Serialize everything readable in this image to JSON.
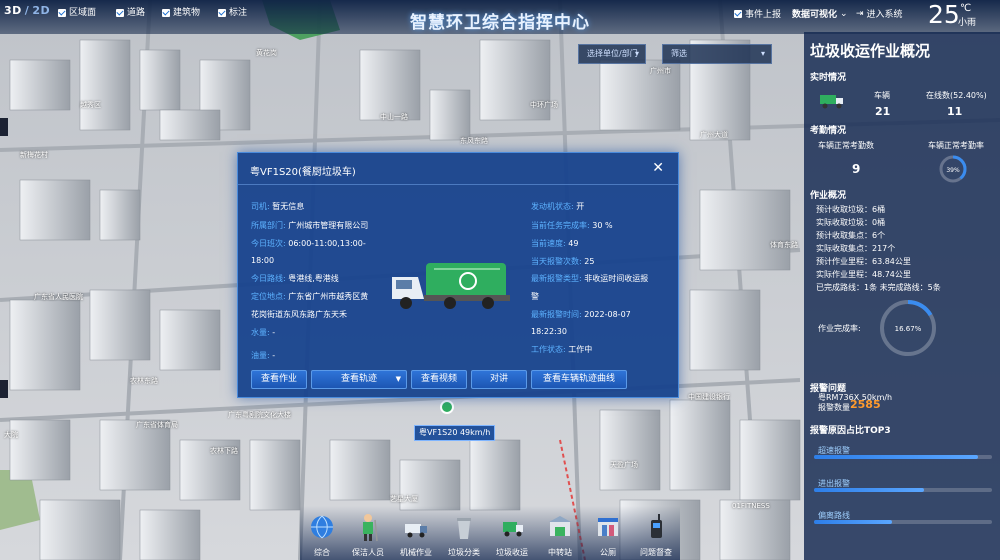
{
  "header": {
    "title": "智慧环卫综合指挥中心",
    "view_3d": "3D",
    "view_sep": "/",
    "view_2d": "2D",
    "layers": [
      "区域面",
      "道路",
      "建筑物",
      "标注"
    ],
    "event_report": "事件上报",
    "data_visual": "数据可视化",
    "enter_system": "进入系统",
    "temperature": "25",
    "temp_unit": "℃",
    "weather": "小雨",
    "select_unit_placeholder": "选择单位/部门",
    "filter_placeholder": "筛选"
  },
  "colors": {
    "accent": "#1b6fd1",
    "panel_bg": "#142850",
    "label_blue": "#5db2ff",
    "highlight_orange": "#ff9b2e",
    "vehicle_green": "#2fae5f"
  },
  "dialog": {
    "title": "粤VF1S20(餐厨垃圾车)",
    "left_fields": [
      {
        "k": "司机:",
        "v": "暂无信息"
      },
      {
        "k": "所属部门:",
        "v": "广州城市管理有限公司"
      },
      {
        "k": "今日班次:",
        "v": "06:00-11:00,13:00-"
      },
      {
        "k": "",
        "v": "18:00"
      },
      {
        "k": "今日路线:",
        "v": "粤港线,粤港线"
      },
      {
        "k": "定位地点:",
        "v": "广东省广州市越秀区黄"
      },
      {
        "k": "",
        "v": "花岗街道东风东路广东天禾"
      },
      {
        "k": "水量:",
        "v": "-"
      },
      {
        "k": "油量:",
        "v": "-"
      }
    ],
    "right_fields": [
      {
        "k": "发动机状态:",
        "v": "开"
      },
      {
        "k": "当前任务完成率:",
        "v": "30 %"
      },
      {
        "k": "当前速度:",
        "v": "49"
      },
      {
        "k": "当天报警次数:",
        "v": "25"
      },
      {
        "k": "最新报警类型:",
        "v": "非收运时间收运报"
      },
      {
        "k": "",
        "v": "警"
      },
      {
        "k": "最新报警时间:",
        "v": "2022-08-07"
      },
      {
        "k": "",
        "v": "18:22:30"
      },
      {
        "k": "工作状态:",
        "v": "工作中"
      }
    ],
    "buttons": {
      "work": "查看作业",
      "track": "查看轨迹",
      "video": "查看视频",
      "intercom": "对讲",
      "curve": "查看车辆轨迹曲线"
    }
  },
  "panel": {
    "title": "垃圾收运作业概况",
    "realtime": "实时情况",
    "vehicles_label": "车辆",
    "vehicles_value": "21",
    "online_label": "在线数(52.40%)",
    "online_value": "11",
    "attendance": "考勤情况",
    "normal_attend_label": "车辆正常考勤数",
    "normal_attend_value": "9",
    "attend_rate_label": "车辆正常考勤率",
    "attend_rate_value": "39%",
    "attend_rate": 0.39,
    "work_overview": "作业概况",
    "work_rows": [
      "预计收取垃圾：6桶",
      "实际收取垃圾：0桶",
      "预计收取集点：6个",
      "实际收取集点：217个",
      "预计作业里程：63.84公里",
      "实际作业里程：48.74公里",
      "已完成路线：1条  未完成路线：5条"
    ],
    "completion_label": "作业完成率:",
    "completion_value": "16.67%",
    "completion": 0.1667,
    "alarm_title": "报警问题",
    "alarm_vehicle": "粤RM736X 50km/h",
    "alarm_count_label": "报警数量",
    "alarm_count_value": "2585",
    "top3_title": "报警原因占比TOP3",
    "top3": [
      {
        "label": "超速报警",
        "ratio": 0.92
      },
      {
        "label": "进出报警",
        "ratio": 0.62
      },
      {
        "label": "偏离路线",
        "ratio": 0.44
      }
    ]
  },
  "map": {
    "vehicle_label": "粤VF1S20 49km/h",
    "labels": [
      "黄花岗",
      "农林下路",
      "广东粤剧院文化大楼",
      "中国建设银行",
      "01FITNESS",
      "艺星大厦",
      "中环广场",
      "广州大道",
      "天盈广场",
      "体育东路",
      "东风东路",
      "农林东路",
      "越秀区",
      "大院",
      "广东省体育局",
      "新梅花村",
      "广东省人民医院",
      "广州市",
      "中山一路"
    ]
  },
  "dock": [
    {
      "label": "综合",
      "icon": "globe-icon"
    },
    {
      "label": "保洁人员",
      "icon": "cleaner-icon"
    },
    {
      "label": "机械作业",
      "icon": "sweeper-truck-icon"
    },
    {
      "label": "垃圾分类",
      "icon": "trash-bin-icon"
    },
    {
      "label": "垃圾收运",
      "icon": "garbage-truck-icon"
    },
    {
      "label": "中转站",
      "icon": "transfer-station-icon"
    },
    {
      "label": "公厕",
      "icon": "toilet-icon"
    },
    {
      "label": "问题督查",
      "icon": "walkie-talkie-icon"
    }
  ]
}
